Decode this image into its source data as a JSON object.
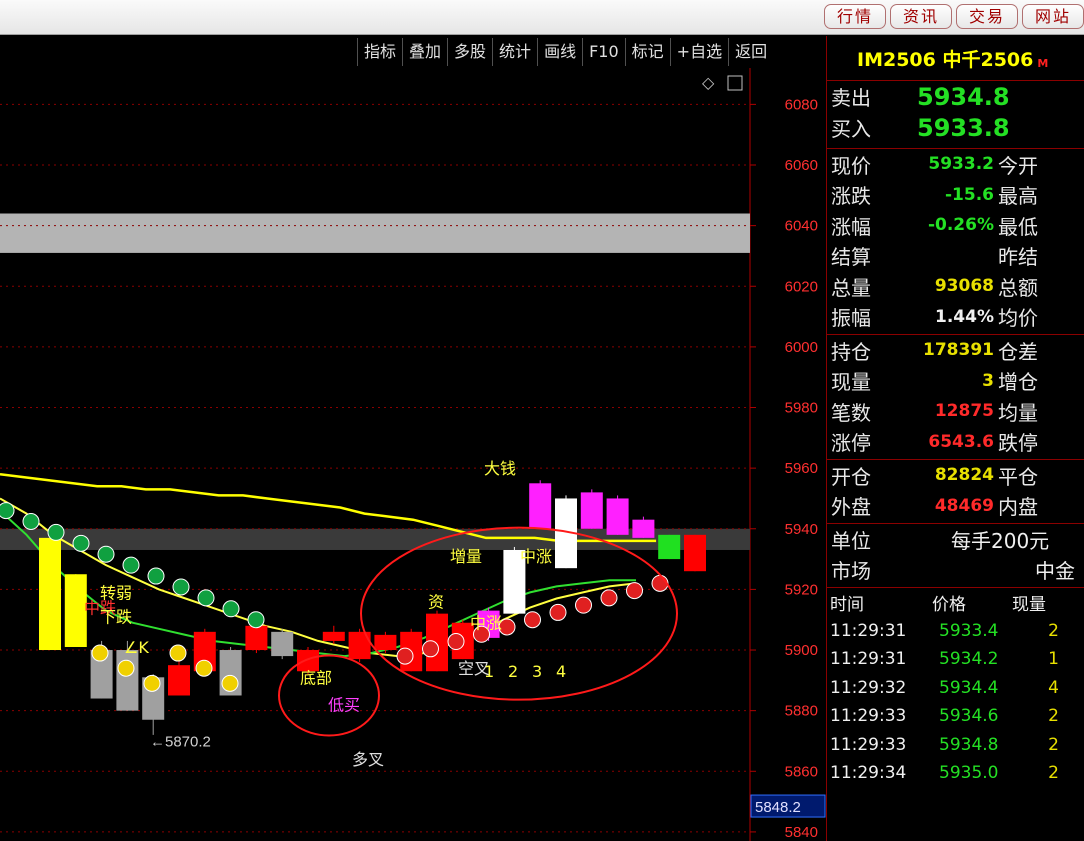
{
  "top_tabs": [
    "行情",
    "资讯",
    "交易",
    "网站"
  ],
  "toolbar": [
    "指标",
    "叠加",
    "多股",
    "统计",
    "画线",
    "F10",
    "标记",
    "+自选",
    "返回"
  ],
  "chart_data": {
    "type": "candlestick",
    "price_axis": [
      "6080",
      "6060",
      "6040",
      "6020",
      "6000",
      "5980",
      "5960",
      "5940",
      "5920",
      "5900",
      "5880",
      "5860",
      "5840"
    ],
    "ylim": [
      5837,
      6092
    ],
    "current_price_label": "5848.2",
    "low_marker": "←5870.2",
    "annotations": [
      "转弱",
      "中跌",
      "下跌",
      "∠K",
      "底部",
      "低买",
      "多叉",
      "资",
      "増量",
      "中涨",
      "大钱",
      "中涨",
      "空叉",
      "1",
      "2",
      "3",
      "4"
    ],
    "candles": [
      {
        "o": 5937,
        "c": 5900,
        "h": 5937,
        "l": 5900,
        "color": "yellow"
      },
      {
        "o": 5925,
        "c": 5901,
        "h": 5925,
        "l": 5901,
        "color": "yellow"
      },
      {
        "o": 5900,
        "c": 5884,
        "h": 5903,
        "l": 5884,
        "color": "gray"
      },
      {
        "o": 5900,
        "c": 5880,
        "h": 5903,
        "l": 5880,
        "color": "gray"
      },
      {
        "o": 5891,
        "c": 5877,
        "h": 5892,
        "l": 5872,
        "color": "gray"
      },
      {
        "o": 5885,
        "c": 5895,
        "h": 5897,
        "l": 5885,
        "color": "red"
      },
      {
        "o": 5893,
        "c": 5906,
        "h": 5907,
        "l": 5892,
        "color": "red"
      },
      {
        "o": 5885,
        "c": 5900,
        "h": 5901,
        "l": 5885,
        "color": "gray"
      },
      {
        "o": 5900,
        "c": 5908,
        "h": 5909,
        "l": 5899,
        "color": "red"
      },
      {
        "o": 5898,
        "c": 5906,
        "h": 5907,
        "l": 5897,
        "color": "gray"
      },
      {
        "o": 5893,
        "c": 5900,
        "h": 5901,
        "l": 5892,
        "color": "red"
      },
      {
        "o": 5903,
        "c": 5906,
        "h": 5908,
        "l": 5902,
        "color": "red"
      },
      {
        "o": 5897,
        "c": 5906,
        "h": 5907,
        "l": 5896,
        "color": "red"
      },
      {
        "o": 5900,
        "c": 5905,
        "h": 5906,
        "l": 5899,
        "color": "red"
      },
      {
        "o": 5893,
        "c": 5906,
        "h": 5907,
        "l": 5893,
        "color": "red"
      },
      {
        "o": 5893,
        "c": 5912,
        "h": 5913,
        "l": 5893,
        "color": "red"
      },
      {
        "o": 5897,
        "c": 5909,
        "h": 5910,
        "l": 5897,
        "color": "red"
      },
      {
        "o": 5904,
        "c": 5913,
        "h": 5914,
        "l": 5903,
        "color": "magenta"
      },
      {
        "o": 5912,
        "c": 5933,
        "h": 5934,
        "l": 5912,
        "color": "white"
      },
      {
        "o": 5940,
        "c": 5955,
        "h": 5956,
        "l": 5940,
        "color": "magenta"
      },
      {
        "o": 5927,
        "c": 5950,
        "h": 5951,
        "l": 5927,
        "color": "white"
      },
      {
        "o": 5940,
        "c": 5952,
        "h": 5953,
        "l": 5940,
        "color": "magenta"
      },
      {
        "o": 5938,
        "c": 5950,
        "h": 5951,
        "l": 5938,
        "color": "magenta"
      },
      {
        "o": 5937,
        "c": 5943,
        "h": 5944,
        "l": 5937,
        "color": "magenta"
      },
      {
        "o": 5930,
        "c": 5938,
        "h": 5938,
        "l": 5930,
        "color": "green"
      },
      {
        "o": 5938,
        "c": 5926,
        "h": 5938,
        "l": 5926,
        "color": "red"
      }
    ],
    "series": [
      {
        "color": "#ffff00",
        "values": [
          5958,
          5957,
          5956,
          5955,
          5954,
          5954,
          5953,
          5953,
          5952,
          5951,
          5951,
          5950,
          5949,
          5948,
          5947,
          5945,
          5944,
          5943,
          5941,
          5939,
          5937,
          5937,
          5937,
          5936,
          5936,
          5936,
          5936,
          5936
        ]
      },
      {
        "color": "#ffff40",
        "values": [
          5950,
          5945,
          5938,
          5933,
          5928,
          5924,
          5920,
          5917,
          5914,
          5911,
          5908,
          5906,
          5903,
          5901,
          5899,
          5898,
          5899,
          5902,
          5905,
          5910,
          5914,
          5917,
          5919,
          5921,
          5922
        ]
      },
      {
        "color": "#30e030",
        "values": [
          5946,
          5938,
          5928,
          5920,
          5913,
          5909,
          5907,
          5905,
          5903,
          5902,
          5901,
          5900,
          5899,
          5898,
          5899,
          5901,
          5904,
          5908,
          5912,
          5916,
          5919,
          5921,
          5922,
          5923,
          5923
        ]
      }
    ]
  },
  "panel": {
    "title": "IM2506 中千2506",
    "title_sub": "M",
    "ask_label": "卖出",
    "ask": "5934.8",
    "bid_label": "买入",
    "bid": "5933.8",
    "rows_a": [
      {
        "l": "现价",
        "v": "5933.2",
        "c": "green",
        "l2": "今开"
      },
      {
        "l": "涨跌",
        "v": "-15.6",
        "c": "green",
        "l2": "最高"
      },
      {
        "l": "涨幅",
        "v": "-0.26%",
        "c": "green",
        "l2": "最低"
      },
      {
        "l": "结算",
        "v": "",
        "c": "white",
        "l2": "昨结"
      },
      {
        "l": "总量",
        "v": "93068",
        "c": "yellow",
        "l2": "总额"
      },
      {
        "l": "振幅",
        "v": "1.44%",
        "c": "white",
        "l2": "均价"
      }
    ],
    "rows_b": [
      {
        "l": "持仓",
        "v": "178391",
        "c": "yellow",
        "l2": "仓差"
      },
      {
        "l": "现量",
        "v": "3",
        "c": "yellow",
        "l2": "增仓"
      },
      {
        "l": "笔数",
        "v": "12875",
        "c": "red",
        "l2": "均量"
      },
      {
        "l": "涨停",
        "v": "6543.6",
        "c": "red",
        "l2": "跌停"
      }
    ],
    "rows_c": [
      {
        "l": "开仓",
        "v": "82824",
        "c": "yellow",
        "l2": "平仓"
      },
      {
        "l": "外盘",
        "v": "48469",
        "c": "red",
        "l2": "内盘"
      }
    ],
    "unit_label": "单位",
    "unit_value": "每手200元",
    "market_label": "市场",
    "market_value": "中金",
    "ticks_header": {
      "time": "时间",
      "price": "价格",
      "vol": "现量"
    },
    "ticks": [
      {
        "t": "11:29:31",
        "p": "5933.4",
        "v": "2"
      },
      {
        "t": "11:29:31",
        "p": "5934.2",
        "v": "1"
      },
      {
        "t": "11:29:32",
        "p": "5934.4",
        "v": "4"
      },
      {
        "t": "11:29:33",
        "p": "5934.6",
        "v": "2"
      },
      {
        "t": "11:29:33",
        "p": "5934.8",
        "v": "2"
      },
      {
        "t": "11:29:34",
        "p": "5935.0",
        "v": "2"
      }
    ]
  }
}
